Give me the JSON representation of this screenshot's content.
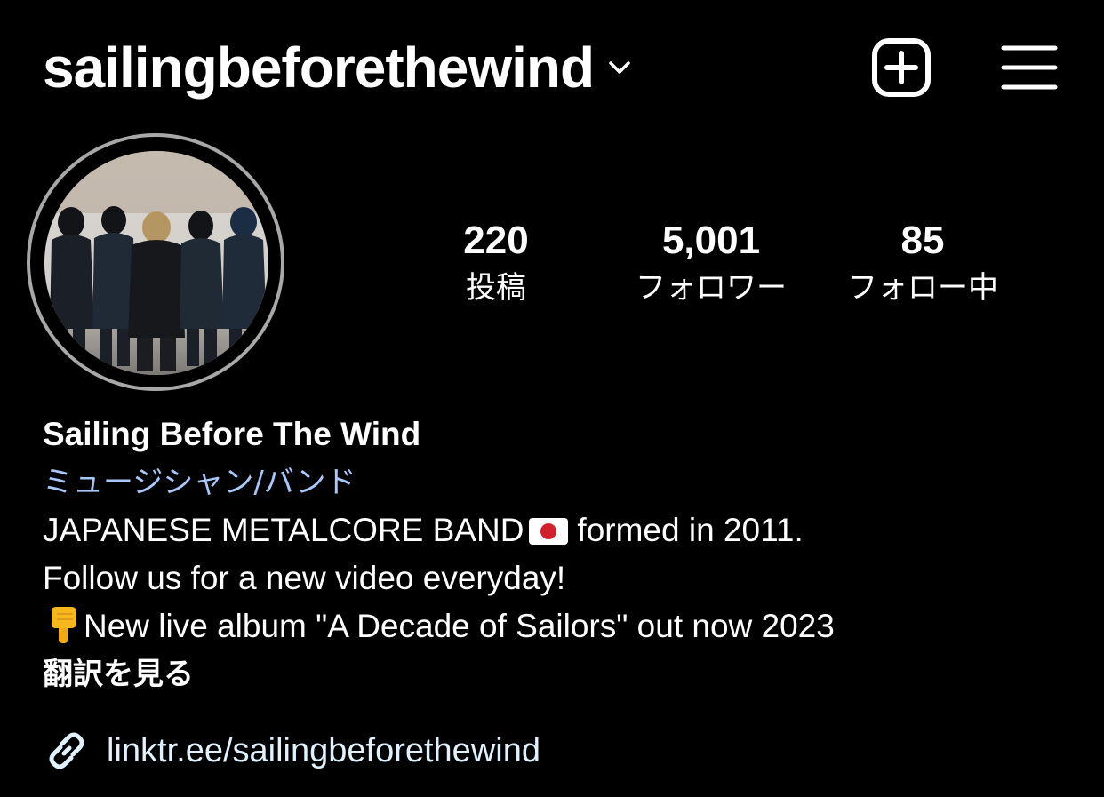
{
  "header": {
    "username": "sailingbeforethewind",
    "chevron_icon": "chevron-down-icon",
    "new_post_icon": "plus-square-icon",
    "menu_icon": "hamburger-menu-icon"
  },
  "stats": {
    "posts": {
      "value": "220",
      "label": "投稿"
    },
    "followers": {
      "value": "5,001",
      "label": "フォロワー"
    },
    "following": {
      "value": "85",
      "label": "フォロー中"
    }
  },
  "bio": {
    "display_name": "Sailing Before The Wind",
    "category": "ミュージシャン/バンド",
    "line1_before_flag": "JAPANESE METALCORE BAND",
    "line1_after_flag": "formed in 2011.",
    "line2": "Follow us for a new video everyday!",
    "line3": "New live album \"A Decade of Sailors\" out now 2023",
    "translate_link": "翻訳を見る"
  },
  "link": {
    "icon": "link-icon",
    "text": "linktr.ee/sailingbeforethewind"
  },
  "colors": {
    "background": "#000000",
    "text": "#ffffff",
    "category": "#a8c7fa",
    "link": "#e0f1ff",
    "avatar_ring": "#a8a8a8"
  }
}
